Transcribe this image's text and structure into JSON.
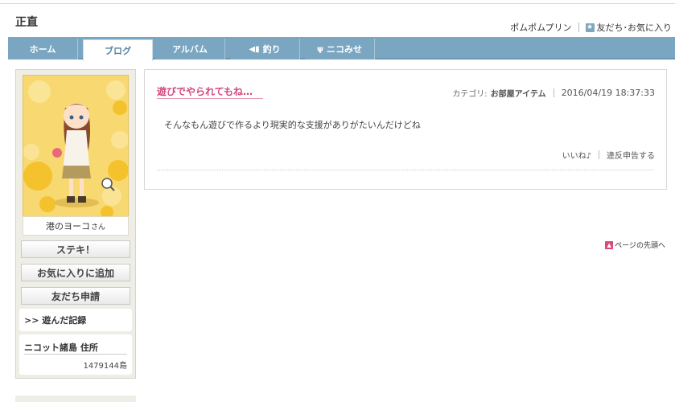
{
  "page": {
    "title": "正直"
  },
  "header": {
    "link1": "ポムポムプリン",
    "link2": "友だち･お気に入り"
  },
  "tabs": [
    {
      "label": "ホーム",
      "icon": ""
    },
    {
      "label": "ブログ",
      "icon": ""
    },
    {
      "label": "アルバム",
      "icon": ""
    },
    {
      "label": "釣り",
      "icon": "fish-icon"
    },
    {
      "label": "ニコみせ",
      "icon": "fork-knife-icon"
    }
  ],
  "sidebar": {
    "name": "港のヨーコ",
    "name_suffix": "さん",
    "suteki_button": "ステキ！",
    "favorite_button": "お気に入りに追加",
    "friend_button": "友だち申請",
    "played_record": ">> 遊んだ記録",
    "address_title": "ニコット諸島 住所",
    "address_value": "1479144島"
  },
  "post": {
    "title": "遊びでやられてもね…",
    "category_label": "カテゴリ:",
    "category_value": "お部屋アイテム",
    "date": "2016/04/19 18:37:33",
    "body": "そんなもん遊びで作るより現実的な支援がありがたいんだけどね",
    "like_label": "いいね♪",
    "report_label": "違反申告する"
  },
  "page_top": "ページの先頭へ",
  "colors": {
    "nav": "#7aa6c2",
    "accent_pink": "#d1497e",
    "sidebar_bg": "#efeee6"
  }
}
